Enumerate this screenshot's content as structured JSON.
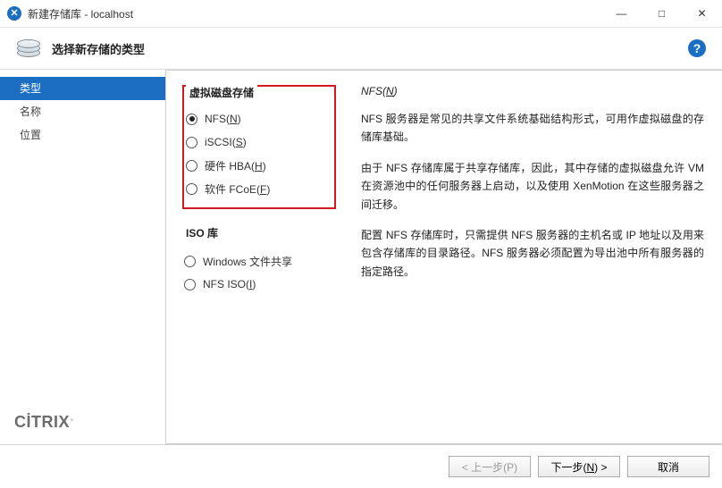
{
  "window": {
    "title": "新建存储库 - localhost",
    "controls": {
      "min": "—",
      "max": "□",
      "close": "✕"
    }
  },
  "header": {
    "title": "选择新存储的类型",
    "help_tooltip": "帮助"
  },
  "sidebar": {
    "items": [
      "类型",
      "名称",
      "位置"
    ],
    "brand": "CİTRIX"
  },
  "options": {
    "vdisk_title": "虚拟磁盘存储",
    "vdisk": [
      {
        "label": "NFS",
        "accel": "N",
        "selected": true
      },
      {
        "label": "iSCSI",
        "accel": "S",
        "selected": false
      },
      {
        "label": "硬件 HBA",
        "accel": "H",
        "selected": false
      },
      {
        "label": "软件 FCoE",
        "accel": "F",
        "selected": false
      }
    ],
    "iso_title": "ISO 库",
    "iso": [
      {
        "label": "Windows 文件共享",
        "accel": "",
        "selected": false
      },
      {
        "label": "NFS ISO",
        "accel": "I",
        "selected": false
      }
    ]
  },
  "description": {
    "title_plain": "NFS",
    "title_accel": "N",
    "paragraphs": [
      "NFS 服务器是常见的共享文件系统基础结构形式，可用作虚拟磁盘的存储库基础。",
      "由于 NFS 存储库属于共享存储库，因此，其中存储的虚拟磁盘允许 VM 在资源池中的任何服务器上启动，以及使用 XenMotion 在这些服务器之间迁移。",
      "配置 NFS 存储库时，只需提供 NFS 服务器的主机名或 IP 地址以及用来包含存储库的目录路径。NFS 服务器必须配置为导出池中所有服务器的指定路径。"
    ]
  },
  "footer": {
    "back": "< 上一步(P)",
    "next_pre": "下一步(",
    "next_accel": "N",
    "next_post": ") >",
    "cancel": "取消"
  }
}
